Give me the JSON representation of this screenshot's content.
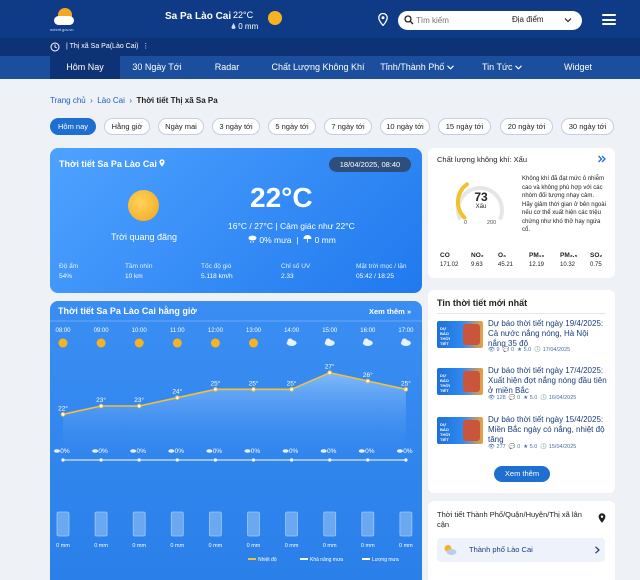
{
  "header": {
    "brand": "nchmf.gov.vn",
    "location": "Sa Pa Lào Cai",
    "temp": "22°C",
    "rain": "0 mm",
    "search_placeholder": "Tìm kiếm",
    "search_scope": "Địa điểm",
    "subbar_location": "Thị xã Sa Pa(Lào Cai)"
  },
  "nav": [
    "Hôm Nay",
    "30 Ngày Tới",
    "Radar",
    "Chất Lượng Không Khí",
    "Tỉnh/Thành Phố",
    "Tin Tức",
    "Widget"
  ],
  "breadcrumb": {
    "home": "Trang chủ",
    "province": "Lào Cai",
    "current": "Thời tiết Thị xã Sa Pa"
  },
  "tabs": [
    "Hôm nay",
    "Hằng giờ",
    "Ngày mai",
    "3 ngày tới",
    "5 ngày tới",
    "7 ngày tới",
    "10 ngày tới",
    "15 ngày tới",
    "20 ngày tới",
    "30 ngày tới"
  ],
  "current": {
    "title": "Thời tiết Sa Pa Lào Cai",
    "datetime": "18/04/2025, 08:40",
    "condition": "Trời quang đãng",
    "temp": "22°C",
    "range": "16°C / 27°C | Cảm giác như 22°C",
    "rain_chance": "0% mưa",
    "rain_amount": "0 mm",
    "stats": [
      {
        "label": "Độ ẩm",
        "value": "54%"
      },
      {
        "label": "Tầm nhìn",
        "value": "10 km"
      },
      {
        "label": "Tốc độ gió",
        "value": "5.118 km/h"
      },
      {
        "label": "Chỉ số UV",
        "value": "2.33"
      },
      {
        "label": "Mặt trời mọc / lặn",
        "value": "05:42 / 18:25"
      }
    ]
  },
  "hourly": {
    "title": "Thời tiết Sa Pa Lào Cai hằng giờ",
    "more": "Xem thêm",
    "legend": [
      "Nhiệt độ",
      "Khả năng mưa",
      "Lượng mưa"
    ]
  },
  "chart_data": {
    "type": "line",
    "x": [
      "08:00",
      "09:00",
      "10:00",
      "11:00",
      "12:00",
      "13:00",
      "14:00",
      "15:00",
      "16:00",
      "17:00"
    ],
    "icons": [
      "sun",
      "sun",
      "sun",
      "sun",
      "sun",
      "sun",
      "cloud",
      "cloud",
      "cloud",
      "cloud"
    ],
    "series": [
      {
        "name": "Nhiệt độ",
        "values": [
          22,
          23,
          23,
          24,
          25,
          25,
          25,
          27,
          26,
          25
        ],
        "unit": "°"
      },
      {
        "name": "Khả năng mưa",
        "values": [
          0,
          0,
          0,
          0,
          0,
          0,
          0,
          0,
          0,
          0
        ],
        "unit": "%"
      },
      {
        "name": "Lượng mưa",
        "values": [
          0,
          0,
          0,
          0,
          0,
          0,
          0,
          0,
          0,
          0
        ],
        "unit": "mm"
      }
    ],
    "ylim": [
      20,
      29
    ],
    "colors": {
      "temp_line": "#f0c040",
      "temp_fill": "#7fb8f5"
    }
  },
  "aqi": {
    "title": "Chất lượng không khí: Xấu",
    "value": "73",
    "label": "Xấu",
    "min": "0",
    "max": "200",
    "fraction": 0.365,
    "description": "Không khí đã đạt mức ô nhiễm cao và không phù hợp với các nhóm đối tượng nhạy cảm. Hãy giảm thời gian ở bên ngoài nếu cơ thể xuất hiện các triệu chứng như khó thở hay ngứa cổ.",
    "pollutants": [
      {
        "name": "CO",
        "value": "171.02"
      },
      {
        "name": "NO₂",
        "value": "9.63"
      },
      {
        "name": "O₃",
        "value": "45.21"
      },
      {
        "name": "PM₁₀",
        "value": "12.19"
      },
      {
        "name": "PM₂.₅",
        "value": "10.32"
      },
      {
        "name": "SO₂",
        "value": "0.75"
      }
    ]
  },
  "news": {
    "title": "Tin thời tiết mới nhất",
    "thumb_tag": "DỰ BÁO THỜI TIẾT",
    "items": [
      {
        "title": "Dự báo thời tiết ngày 19/4/2025: Cả nước nắng nóng, Hà Nội nắng 35 độ",
        "views": "9",
        "comments": "0",
        "rating": "5.0",
        "date": "17/04/2025"
      },
      {
        "title": "Dự báo thời tiết ngày 17/4/2025: Xuất hiện đợt nắng nóng đầu tiên ở miền Bắc",
        "views": "128",
        "comments": "0",
        "rating": "5.0",
        "date": "16/04/2025"
      },
      {
        "title": "Dự báo thời tiết ngày 15/4/2025: Miền Bắc ngày có nắng, nhiệt độ tăng",
        "views": "277",
        "comments": "0",
        "rating": "5.0",
        "date": "15/04/2025"
      }
    ],
    "more": "Xem thêm"
  },
  "nearby": {
    "title": "Thời tiết Thành Phố/Quận/Huyện/Thị xã lân cận",
    "item": "Thành phố Lào Cai"
  }
}
